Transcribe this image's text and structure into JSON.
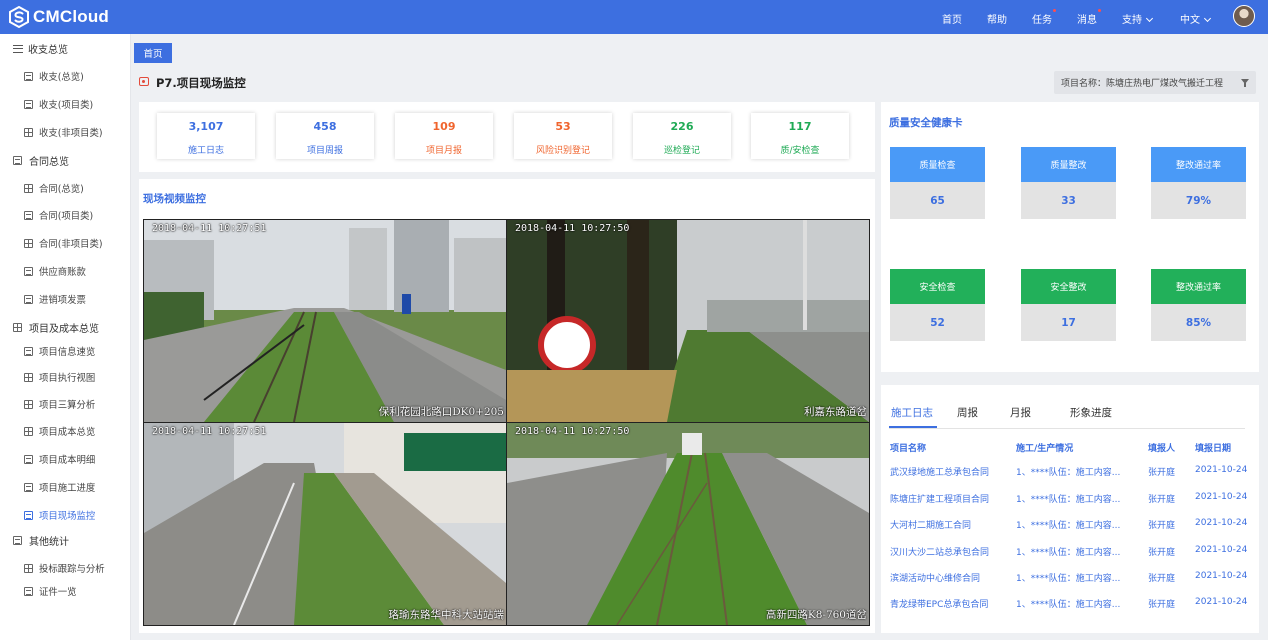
{
  "header": {
    "brand": "CMCloud",
    "nav": [
      {
        "label": "首页",
        "badge": false,
        "dropdown": false
      },
      {
        "label": "帮助",
        "badge": false,
        "dropdown": false
      },
      {
        "label": "任务",
        "badge": true,
        "dropdown": false
      },
      {
        "label": "消息",
        "badge": true,
        "dropdown": false
      },
      {
        "label": "支持",
        "badge": false,
        "dropdown": true
      },
      {
        "label": "中文",
        "badge": false,
        "dropdown": true
      }
    ]
  },
  "sidebar": {
    "groups": [
      {
        "label": "收支总览",
        "items": [
          "收支(总览)",
          "收支(项目类)",
          "收支(非项目类)"
        ]
      },
      {
        "label": "合同总览",
        "items": [
          "合同(总览)",
          "合同(项目类)",
          "合同(非项目类)",
          "供应商账款",
          "进销项发票"
        ]
      },
      {
        "label": "项目及成本总览",
        "items": [
          "项目信息速览",
          "项目执行视图",
          "项目三算分析",
          "项目成本总览",
          "项目成本明细",
          "项目施工进度",
          "项目现场监控"
        ]
      },
      {
        "label": "其他统计",
        "items": [
          "投标跟踪与分析",
          "证件一览"
        ]
      }
    ],
    "active": "项目现场监控"
  },
  "tabs": {
    "home": "首页"
  },
  "page": {
    "title": "P7.项目现场监控",
    "project_filter": "项目名称：陈塘庄热电厂煤改气搬迁工程"
  },
  "stats": [
    {
      "value": "3,107",
      "label": "施工日志",
      "color": "#3d6fe0"
    },
    {
      "value": "458",
      "label": "项目周报",
      "color": "#3d6fe0"
    },
    {
      "value": "109",
      "label": "项目月报",
      "color": "#f0642d"
    },
    {
      "value": "53",
      "label": "风险识别登记",
      "color": "#f0642d"
    },
    {
      "value": "226",
      "label": "巡检登记",
      "color": "#1faa55"
    },
    {
      "value": "117",
      "label": "质/安检查",
      "color": "#1faa55"
    }
  ],
  "video": {
    "title": "现场视频监控",
    "cameras": [
      {
        "timestamp": "2018-04-11 10:27:51",
        "location": "保利花园北路口DK0+205"
      },
      {
        "timestamp": "2018-04-11 10:27:50",
        "location": "利嘉东路道岔"
      },
      {
        "timestamp": "2018-04-11 10:27:51",
        "location": "珞瑜东路华中科大站站端"
      },
      {
        "timestamp": "2018-04-11 10:27:50",
        "location": "高新四路K8-760道岔"
      }
    ]
  },
  "health": {
    "title": "质量安全健康卡",
    "quality": [
      {
        "label": "质量检查",
        "value": "65"
      },
      {
        "label": "质量整改",
        "value": "33"
      },
      {
        "label": "整改通过率",
        "value": "79%"
      }
    ],
    "safety": [
      {
        "label": "安全检查",
        "value": "52"
      },
      {
        "label": "安全整改",
        "value": "17"
      },
      {
        "label": "整改通过率",
        "value": "85%"
      }
    ],
    "colors": {
      "quality": "#4a9af7",
      "safety": "#22b05a",
      "value_text": "#3d6fe0"
    }
  },
  "log": {
    "tabs": [
      "施工日志",
      "周报",
      "月报",
      "形象进度"
    ],
    "active_tab": "施工日志",
    "columns": [
      "项目名称",
      "施工/生产情况",
      "填报人",
      "填报日期"
    ],
    "rows": [
      [
        "武汉绿地施工总承包合同",
        "1、****队伍：施工内容...",
        "张开庭",
        "2021-10-24"
      ],
      [
        "陈塘庄扩建工程项目合同",
        "1、****队伍：施工内容...",
        "张开庭",
        "2021-10-24"
      ],
      [
        "大河村二期施工合同",
        "1、****队伍：施工内容...",
        "张开庭",
        "2021-10-24"
      ],
      [
        "汉川大沙二站总承包合同",
        "1、****队伍：施工内容...",
        "张开庭",
        "2021-10-24"
      ],
      [
        "滨湖活动中心维修合同",
        "1、****队伍：施工内容...",
        "张开庭",
        "2021-10-24"
      ],
      [
        "青龙绿带EPC总承包合同",
        "1、****队伍：施工内容...",
        "张开庭",
        "2021-10-24"
      ]
    ]
  }
}
